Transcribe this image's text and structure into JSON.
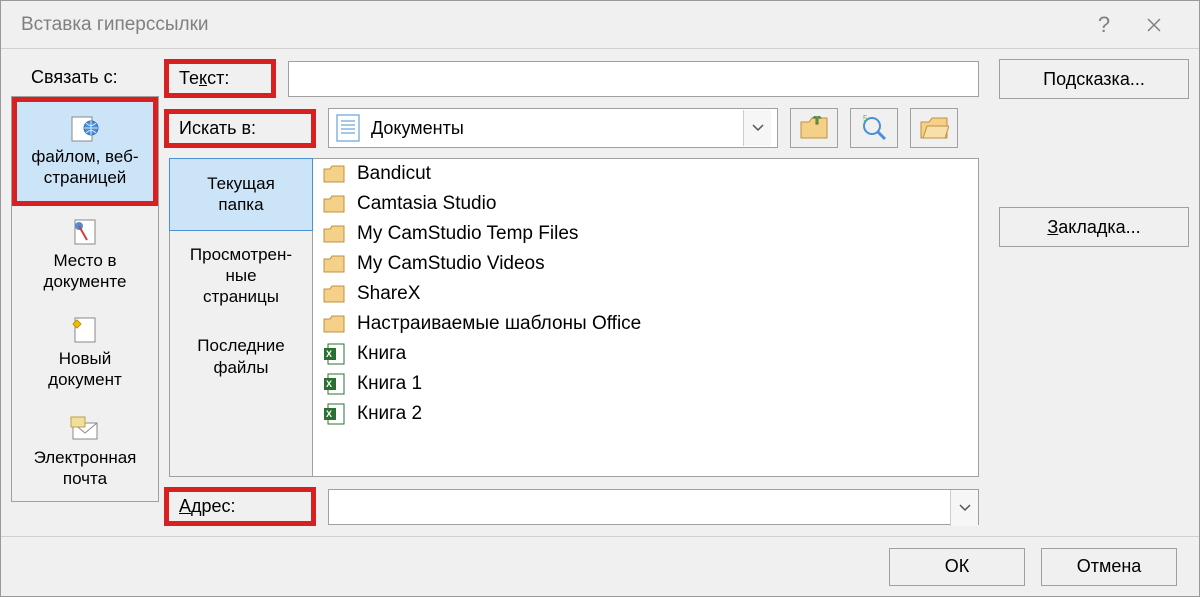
{
  "titlebar": {
    "title": "Вставка гиперссылки"
  },
  "labels": {
    "link_with": "Связать с:",
    "text": "Текст:",
    "lookin": "Искать в:",
    "address": "Адрес:"
  },
  "text_value": "",
  "address_value": "",
  "link_options": [
    {
      "id": "file-web",
      "lines": [
        "файлом, веб-",
        "страницей"
      ],
      "selected": true
    },
    {
      "id": "place-in-doc",
      "lines": [
        "Место в",
        "документе"
      ],
      "selected": false
    },
    {
      "id": "new-doc",
      "lines": [
        "Новый",
        "документ"
      ],
      "selected": false
    },
    {
      "id": "email",
      "lines": [
        "Электронная",
        "почта"
      ],
      "selected": false
    }
  ],
  "lookin_value": "Документы",
  "tabs": [
    {
      "id": "current-folder",
      "lines": [
        "Текущая",
        "папка"
      ],
      "selected": true
    },
    {
      "id": "browsed-pages",
      "lines": [
        "Просмотрен-",
        "ные",
        "страницы"
      ],
      "selected": false
    },
    {
      "id": "recent-files",
      "lines": [
        "Последние",
        "файлы"
      ],
      "selected": false
    }
  ],
  "files": [
    {
      "name": "Bandicut",
      "type": "folder"
    },
    {
      "name": "Camtasia Studio",
      "type": "folder"
    },
    {
      "name": "My CamStudio Temp Files",
      "type": "folder"
    },
    {
      "name": "My CamStudio Videos",
      "type": "folder"
    },
    {
      "name": "ShareX",
      "type": "folder"
    },
    {
      "name": "Настраиваемые шаблоны Office",
      "type": "folder"
    },
    {
      "name": "Книга",
      "type": "excel"
    },
    {
      "name": "Книга 1",
      "type": "excel"
    },
    {
      "name": "Книга 2",
      "type": "excel"
    }
  ],
  "buttons": {
    "screentip": "Подсказка...",
    "bookmark": "Закладка...",
    "ok": "ОК",
    "cancel": "Отмена"
  }
}
